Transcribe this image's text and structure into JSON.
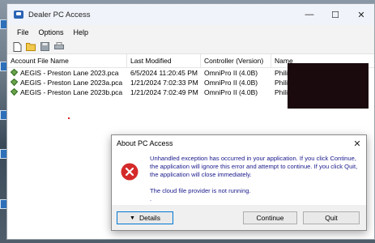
{
  "window": {
    "title": "Dealer PC Access",
    "controls": {
      "minimize": "—",
      "maximize": "☐",
      "close": "✕"
    }
  },
  "menu": [
    "File",
    "Options",
    "Help"
  ],
  "toolbar": [
    "new-file-icon",
    "open-folder-icon",
    "save-icon",
    "print-icon"
  ],
  "table": {
    "headers": [
      "Account File Name",
      "Last Modified",
      "Controller (Version)",
      "Name"
    ],
    "rows": [
      [
        "AEGIS - Preston Lane 2023.pca",
        "6/5/2024 11:20:45 PM",
        "OmniPro II (4.0B)",
        "Philip J"
      ],
      [
        "AEGIS - Preston Lane 2023a.pca",
        "1/21/2024 7:02:33 PM",
        "OmniPro II (4.0B)",
        "Philip J"
      ],
      [
        "AEGIS - Preston Lane 2023b.pca",
        "1/21/2024 7:02:49 PM",
        "OmniPro II (4.0B)",
        "Philip J"
      ]
    ]
  },
  "dialog": {
    "title": "About PC Access",
    "close": "✕",
    "message": "Unhandled exception has occurred in your application. If you click Continue, the application will ignore this error and attempt to continue. If you click Quit, the application will close immediately.",
    "detail": "The cloud file provider is not running.",
    "detail_extra": ".",
    "buttons": {
      "details": "Details",
      "continue": "Continue",
      "quit": "Quit"
    },
    "details_arrow": "▼"
  },
  "colors": {
    "accent": "#0078d4",
    "error": "#d42a2a",
    "message_text": "#1a1a8c"
  }
}
